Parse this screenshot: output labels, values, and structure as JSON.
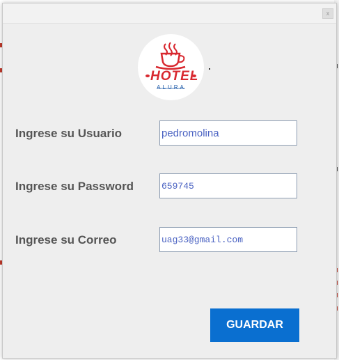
{
  "window": {
    "close_label": "x"
  },
  "logo": {
    "brand_text": "HOTEL",
    "sub_text": "ALURA",
    "brand_color": "#d8282f"
  },
  "form": {
    "usuario": {
      "label": "Ingrese su Usuario",
      "value": "pedromolina"
    },
    "password": {
      "label": "Ingrese su Password",
      "value": "659745"
    },
    "correo": {
      "label": "Ingrese su Correo",
      "value": "uag33@gmail.com"
    }
  },
  "actions": {
    "save_label": "GUARDAR"
  },
  "colors": {
    "accent": "#0a6fd0",
    "input_text": "#4a62c2",
    "label_text": "#555555",
    "dialog_bg": "#eeeeee"
  }
}
